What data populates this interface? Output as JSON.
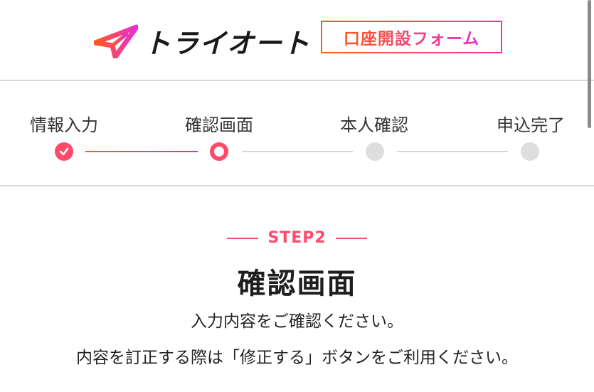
{
  "header": {
    "brand_name": "トライオート",
    "form_badge": "口座開設フォーム",
    "brand_colors": {
      "accent_start": "#ff5a1e",
      "accent_end": "#e62fd0"
    }
  },
  "progress": {
    "steps": [
      {
        "label": "情報入力",
        "state": "done"
      },
      {
        "label": "確認画面",
        "state": "current"
      },
      {
        "label": "本人確認",
        "state": "todo"
      },
      {
        "label": "申込完了",
        "state": "todo"
      }
    ]
  },
  "main": {
    "step_number": "STEP2",
    "title": "確認画面",
    "description_1": "入力内容をご確認ください。",
    "description_2": "内容を訂正する際は「修正する」ボタンをご利用ください。"
  },
  "colors": {
    "accent": "#ff4a6a",
    "inactive": "#dedede"
  }
}
